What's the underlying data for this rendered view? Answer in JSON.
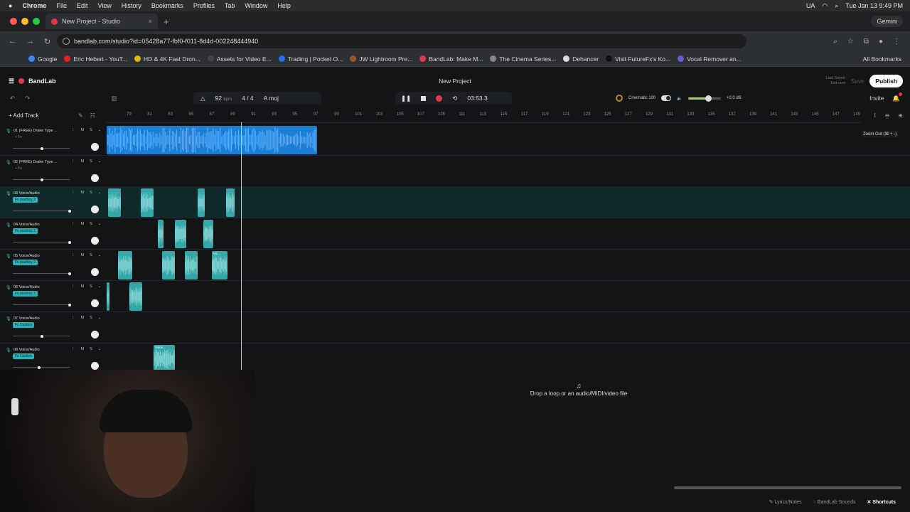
{
  "menubar": {
    "app": "Chrome",
    "items": [
      "File",
      "Edit",
      "View",
      "History",
      "Bookmarks",
      "Profiles",
      "Tab",
      "Window",
      "Help"
    ],
    "lang": "UA",
    "datetime": "Tue Jan 13  9:49 PM"
  },
  "browser": {
    "tab_title": "New Project - Studio",
    "url": "bandlab.com/studio?id=05428a77-fbf0-f011-8d4d-002248444940",
    "gemini": "Gemini",
    "bookmarks": [
      {
        "label": "Google",
        "color": "#4285f4"
      },
      {
        "label": "Eric Hebert - YouT...",
        "color": "#e62117"
      },
      {
        "label": "HD & 4K Fast Dron...",
        "color": "#e2b800"
      },
      {
        "label": "Assets for Video E...",
        "color": "#444444"
      },
      {
        "label": "Trading | Pocket O...",
        "color": "#2b6cf5"
      },
      {
        "label": "JW Lightroom Pre...",
        "color": "#a0522d"
      },
      {
        "label": "BandLab: Make M...",
        "color": "#e2384a"
      },
      {
        "label": "The Cinema Series...",
        "color": "#888888"
      },
      {
        "label": "Dehancer",
        "color": "#dddddd"
      },
      {
        "label": "Visit FutureFx's Ko...",
        "color": "#111111"
      },
      {
        "label": "Vocal Remover an...",
        "color": "#6b5bd6"
      }
    ],
    "all_bookmarks": "All Bookmarks"
  },
  "studio": {
    "brand": "BandLab",
    "project_title": "New Project",
    "last_saved_label": "Last Saved",
    "last_saved_value": "Just now",
    "save": "Save",
    "publish": "Publish",
    "tempo": "92",
    "tempo_unit": "bpm",
    "time_sig": "4 / 4",
    "key": "A moj",
    "time": "03:53.3",
    "fx_name": "Cinematic",
    "fx_value": "100",
    "volume_db": "+0.0 dB",
    "invite": "Invite",
    "add_track": "Add Track",
    "zoom_tooltip": "Zoom Out (⌘ + -)",
    "drop_text": "Drop a loop or an audio/MIDI/video file"
  },
  "ruler": [
    "79",
    "81",
    "83",
    "85",
    "87",
    "89",
    "91",
    "93",
    "95",
    "97",
    "99",
    "101",
    "103",
    "105",
    "107",
    "109",
    "111",
    "113",
    "115",
    "117",
    "119",
    "121",
    "123",
    "125",
    "127",
    "129",
    "131",
    "133",
    "135",
    "137",
    "139",
    "141",
    "143",
    "145",
    "147",
    "149"
  ],
  "tracks": [
    {
      "name": "01  (FREE) Drake Type ...",
      "fx": "+ Fx",
      "fx_plain": true,
      "vol": 0.5,
      "clips": [
        {
          "start": 0,
          "width": 296,
          "color": "blue",
          "label": ""
        }
      ]
    },
    {
      "name": "02  (FREE) Drake Type ...",
      "fx": "+ Fx",
      "fx_plain": true,
      "vol": 0.5,
      "clips": []
    },
    {
      "name": "03  Voice/Audio",
      "fx": "Fx poetboy 2",
      "fx_plain": false,
      "vol": 1.0,
      "selected": true,
      "clips": [
        {
          "start": 2,
          "width": 18,
          "color": "teal",
          "label": ""
        },
        {
          "start": 48,
          "width": 18,
          "color": "teal",
          "label": ""
        },
        {
          "start": 128,
          "width": 10,
          "color": "teal",
          "label": ""
        },
        {
          "start": 168,
          "width": 12,
          "color": "teal",
          "label": ""
        }
      ]
    },
    {
      "name": "04  Voice/Audio",
      "fx": "Fx poetboy 2",
      "fx_plain": false,
      "vol": 1.0,
      "clips": [
        {
          "start": 72,
          "width": 8,
          "color": "teal",
          "label": ""
        },
        {
          "start": 96,
          "width": 16,
          "color": "teal",
          "label": ""
        },
        {
          "start": 136,
          "width": 14,
          "color": "teal",
          "label": ""
        }
      ]
    },
    {
      "name": "05  Voice/Audio",
      "fx": "Fx poetboy 2",
      "fx_plain": false,
      "vol": 1.0,
      "clips": [
        {
          "start": 16,
          "width": 20,
          "color": "teal",
          "label": ""
        },
        {
          "start": 78,
          "width": 18,
          "color": "teal",
          "label": ""
        },
        {
          "start": 110,
          "width": 18,
          "color": "teal",
          "label": ""
        },
        {
          "start": 148,
          "width": 22,
          "color": "teal",
          "label": "Voi..."
        }
      ]
    },
    {
      "name": "06  Voice/Audio",
      "fx": "Fx poetboy 2",
      "fx_plain": false,
      "vol": 1.0,
      "clips": [
        {
          "start": 0,
          "width": 4,
          "color": "teal",
          "label": ""
        },
        {
          "start": 32,
          "width": 18,
          "color": "teal",
          "label": ""
        }
      ]
    },
    {
      "name": "07  Voice/Audio",
      "fx": "Fx Custom",
      "fx_plain": false,
      "vol": 0.5,
      "clips": []
    },
    {
      "name": "08  Voice/Audio",
      "fx": "Fx Custom",
      "fx_plain": false,
      "vol": 0.45,
      "clips": [
        {
          "start": 66,
          "width": 30,
          "color": "teal",
          "label": "Voice..."
        }
      ]
    }
  ],
  "footer": {
    "lyrics": "Lyrics/Notes",
    "sounds": "BandLab Sounds",
    "shortcuts": "Shortcuts"
  }
}
